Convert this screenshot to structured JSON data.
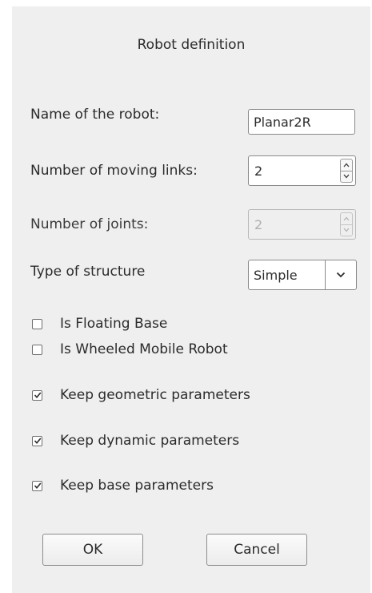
{
  "dialog": {
    "title": "Robot definition",
    "fields": {
      "robot_name": {
        "label": "Name of the robot:",
        "value": "Planar2R"
      },
      "moving_links": {
        "label": "Number of moving links:",
        "value": "2"
      },
      "joints": {
        "label": "Number of joints:",
        "value": "2"
      },
      "structure": {
        "label": "Type of structure",
        "value": "Simple"
      }
    },
    "options": {
      "floating_base": {
        "label": "Is Floating Base",
        "checked": false
      },
      "wheeled_mobile": {
        "label": "Is Wheeled Mobile Robot",
        "checked": false
      },
      "keep_geometric": {
        "label": "Keep geometric parameters",
        "checked": true
      },
      "keep_dynamic": {
        "label": "Keep dynamic parameters",
        "checked": true
      },
      "keep_base": {
        "label": "Keep base parameters",
        "checked": true
      }
    },
    "buttons": {
      "ok": "OK",
      "cancel": "Cancel"
    },
    "icons": {
      "spin_up": "chevron-up-icon",
      "spin_down": "chevron-down-icon",
      "combo_arrow": "chevron-down-icon",
      "check": "checkmark-icon"
    }
  }
}
